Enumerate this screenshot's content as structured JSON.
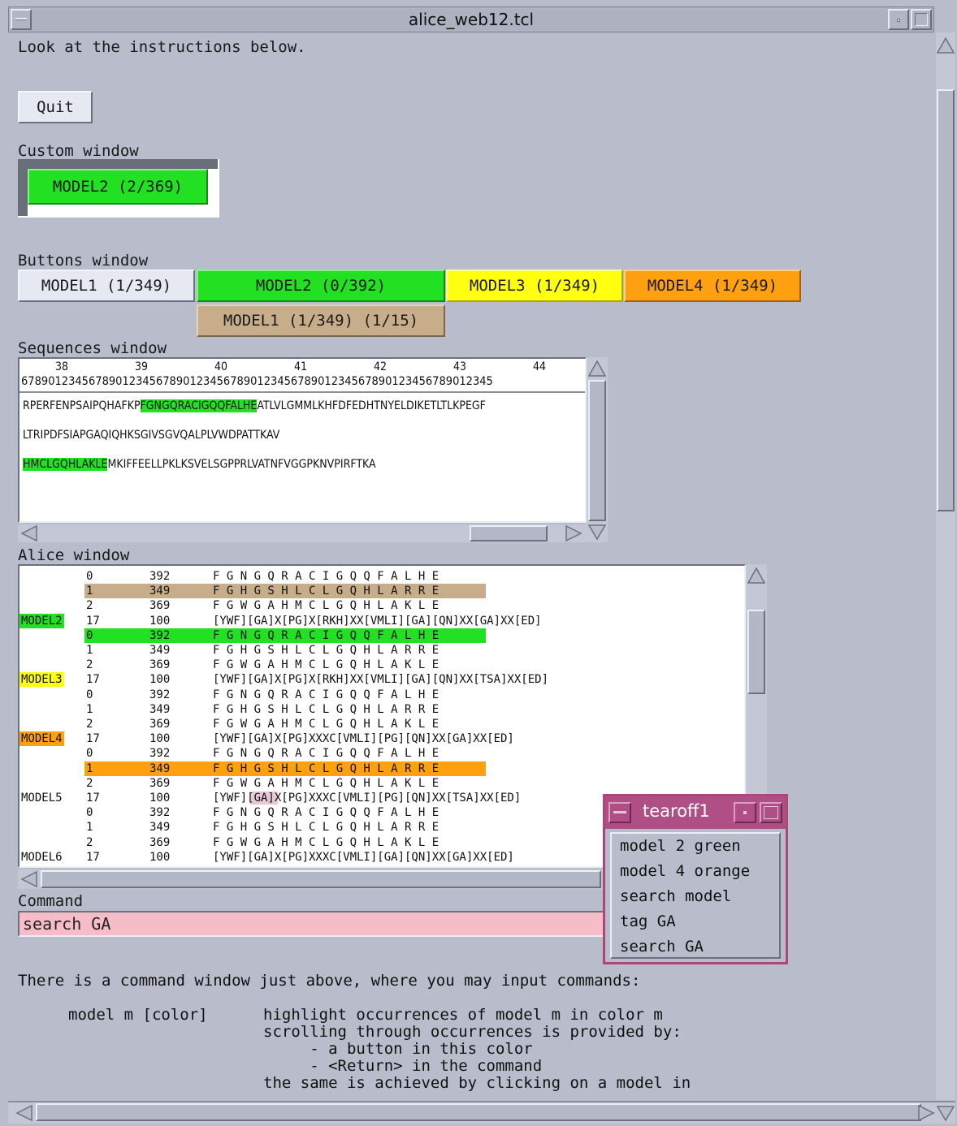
{
  "window": {
    "title": "alice_web12.tcl"
  },
  "intro": "Look at the instructions below.",
  "quit_label": "Quit",
  "custom_window": {
    "label": "Custom window",
    "button": "MODEL2 (2/369)"
  },
  "buttons_window": {
    "label": "Buttons window",
    "buttons": [
      {
        "label": "MODEL1 (1/349)",
        "color": "#e6e8f2"
      },
      {
        "label": "MODEL2 (0/392)",
        "color": "#22e022"
      },
      {
        "label": "MODEL3 (1/349)",
        "color": "#ffff10"
      },
      {
        "label": "MODEL4 (1/349)",
        "color": "#ffa010"
      },
      {
        "label": "MODEL1 (1/349) (1/15)",
        "color": "#c8ad8a"
      }
    ]
  },
  "sequences_window": {
    "label": "Sequences window",
    "ruler_numbers": [
      "38",
      "39",
      "40",
      "41",
      "42",
      "43",
      "44"
    ],
    "ruler_digits": "6789012345678901234567890123456789012345678901234567890123456789012345",
    "lines": [
      {
        "pre": "RPERFENPSAIPQHAFKP",
        "hl": "FGNGQRACIGQQFALHE",
        "post": "ATLVLGMMLKHFDFEDHTNYELDIKETLTLKPEGF"
      },
      {
        "pre": "LTRIPDFSIAPGAQIQHKSGIVSGVQALPLVWDPATTKAV",
        "hl": "",
        "post": ""
      },
      {
        "pre": "",
        "hl": "HMCLGQHLAKLE",
        "post": "MKIFFEELLPKLKSVELSGPPRLVATNFVGGPKNVPIRFTKA"
      }
    ]
  },
  "alice_window": {
    "label": "Alice window",
    "rows": [
      {
        "name": "",
        "idx": "0",
        "len": "392",
        "seq": "F G N G Q R A C I G Q Q F A L H E",
        "bg": ""
      },
      {
        "name": "",
        "idx": "1",
        "len": "349",
        "seq": "F G H G S H L C L G Q H L A R R E",
        "bg": "#c8ad8a"
      },
      {
        "name": "",
        "idx": "2",
        "len": "369",
        "seq": "F G W G A H M C L G Q H L A K L E",
        "bg": ""
      },
      {
        "name": "MODEL2",
        "idx": "17",
        "len": "100",
        "seq": "[YWF][GA]X[PG]X[RKH]XX[VMLI][GA][QN]XX[GA]XX[ED]",
        "bg": "",
        "name_bg": "#22e022"
      },
      {
        "name": "",
        "idx": "0",
        "len": "392",
        "seq": "F G N G Q R A C I G Q Q F A L H E",
        "bg": "#22e022"
      },
      {
        "name": "",
        "idx": "1",
        "len": "349",
        "seq": "F G H G S H L C L G Q H L A R R E",
        "bg": ""
      },
      {
        "name": "",
        "idx": "2",
        "len": "369",
        "seq": "F G W G A H M C L G Q H L A K L E",
        "bg": ""
      },
      {
        "name": "MODEL3",
        "idx": "17",
        "len": "100",
        "seq": "[YWF][GA]X[PG]X[RKH]XX[VMLI][GA][QN]XX[TSA]XX[ED]",
        "bg": "",
        "name_bg": "#ffff10"
      },
      {
        "name": "",
        "idx": "0",
        "len": "392",
        "seq": "F G N G Q R A C I G Q Q F A L H E",
        "bg": ""
      },
      {
        "name": "",
        "idx": "1",
        "len": "349",
        "seq": "F G H G S H L C L G Q H L A R R E",
        "bg": ""
      },
      {
        "name": "",
        "idx": "2",
        "len": "369",
        "seq": "F G W G A H M C L G Q H L A K L E",
        "bg": ""
      },
      {
        "name": "MODEL4",
        "idx": "17",
        "len": "100",
        "seq": "[YWF][GA]X[PG]XXXC[VMLI][PG][QN]XX[GA]XX[ED]",
        "bg": "",
        "name_bg": "#ffa010"
      },
      {
        "name": "",
        "idx": "0",
        "len": "392",
        "seq": "F G N G Q R A C I G Q Q F A L H E",
        "bg": ""
      },
      {
        "name": "",
        "idx": "1",
        "len": "349",
        "seq": "F G H G S H L C L G Q H L A R R E",
        "bg": "#ffa010"
      },
      {
        "name": "",
        "idx": "2",
        "len": "369",
        "seq": "F G W G A H M C L G Q H L A K L E",
        "bg": ""
      },
      {
        "name": "MODEL5",
        "idx": "17",
        "len": "100",
        "seq": "[YWF][GA]X[PG]XXXC[VMLI][PG][QN]XX[TSA]XX[ED]",
        "bg": ""
      },
      {
        "name": "",
        "idx": "0",
        "len": "392",
        "seq": "F G N G Q R A C I G Q Q F A L H E",
        "bg": ""
      },
      {
        "name": "",
        "idx": "1",
        "len": "349",
        "seq": "F G H G S H L C L G Q H L A R R E",
        "bg": ""
      },
      {
        "name": "",
        "idx": "2",
        "len": "369",
        "seq": "F G W G A H M C L G Q H L A K L E",
        "bg": ""
      },
      {
        "name": "MODEL6",
        "idx": "17",
        "len": "100",
        "seq": "[YWF][GA]X[PG]XXXC[VMLI][GA][QN]XX[GA]XX[ED]",
        "bg": ""
      }
    ]
  },
  "tearoff": {
    "title": "tearoff1",
    "items": [
      "model 2 green",
      "model 4 orange",
      "search model",
      "tag GA",
      "search GA"
    ]
  },
  "command": {
    "label": "Command",
    "value": "search GA"
  },
  "help": {
    "intro": "There is a command window just above, where you may input commands:",
    "cmd": "model m [color]",
    "lines": [
      "highlight occurrences of model m in color m",
      "scrolling through occurrences is provided by:",
      "     - a button in this color",
      "     - <Return> in the command",
      "the same is achieved by clicking on a model in"
    ]
  },
  "colors": {
    "bg": "#b8bccb",
    "green": "#22e022",
    "yellow": "#ffff10",
    "orange": "#ffa010",
    "tan": "#c8ad8a",
    "pink": "#f6bdc8",
    "tearoff": "#b04f86"
  }
}
